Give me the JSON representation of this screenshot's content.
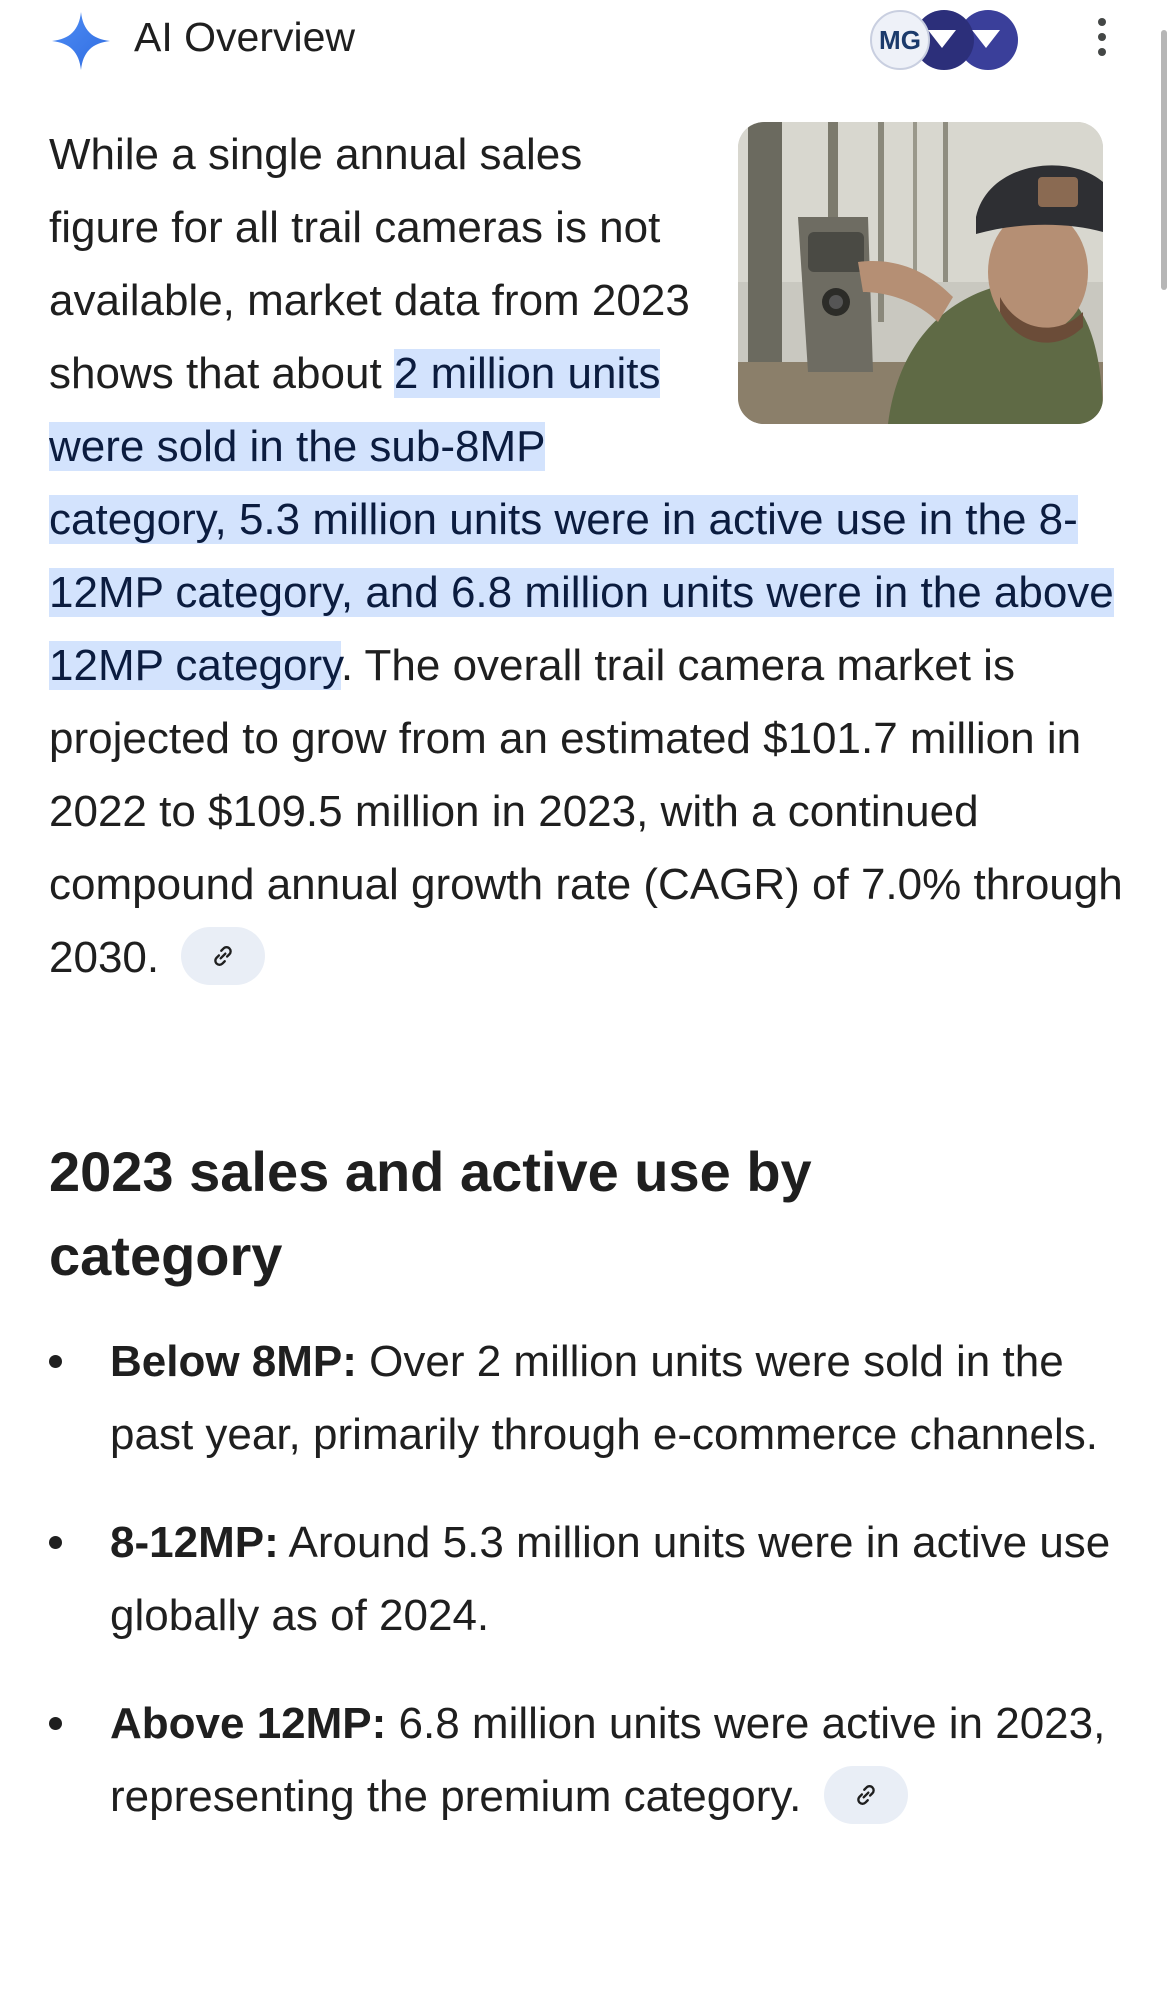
{
  "header": {
    "title": "AI Overview",
    "avatar_badge": "MG",
    "icons": [
      "sparkle-icon",
      "avatar-stack",
      "more-vert-icon"
    ]
  },
  "summary": {
    "text_before": "While a single annual sales figure for all trail cameras is not available, market data from 2023 shows that about ",
    "highlight": "2 million units were sold in the sub-8MP category, 5.3 million units were in active use in the 8-12MP category, and 6.8 million units were in the above 12MP category",
    "text_after": ". The overall trail camera market is projected to grow from an estimated $101.7 million in 2022 to $109.5 million in 2023, with a continued compound annual growth rate (CAGR) of 7.0% through 2030.",
    "image_subject": "man in cap mounting a trail camera on a tree"
  },
  "section": {
    "heading": "2023 sales and active use by category",
    "items": [
      {
        "label": "Below 8MP:",
        "text": " Over 2 million units were sold in the past year, primarily through e-commerce channels."
      },
      {
        "label": "8-12MP:",
        "text": " Around 5.3 million units were in active use globally as of 2024."
      },
      {
        "label": "Above 12MP:",
        "text": " 6.8 million units were active in 2023, representing the premium category."
      }
    ]
  },
  "colors": {
    "highlight_bg": "#d3e3fd",
    "chip_bg": "#e9eef6",
    "text": "#1f1f1f"
  }
}
